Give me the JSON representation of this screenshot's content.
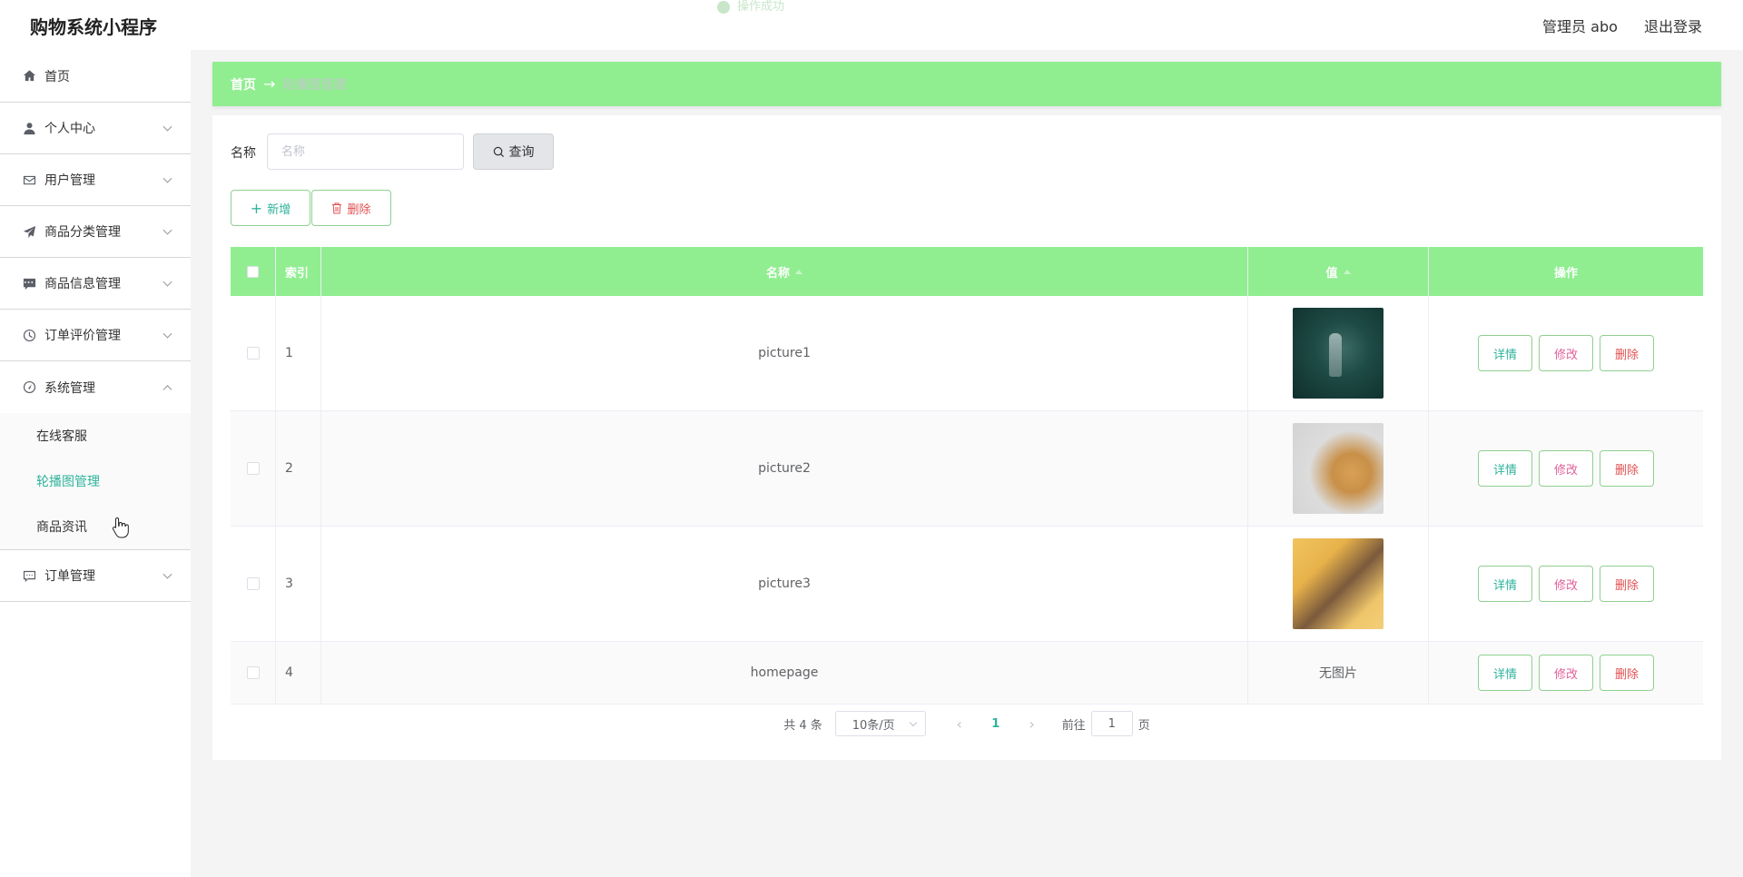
{
  "app": {
    "title": "购物系统小程序"
  },
  "toast": {
    "message": "操作成功"
  },
  "header": {
    "user_label": "管理员 abo",
    "logout_label": "退出登录"
  },
  "sidebar": {
    "items": [
      {
        "label": "首页",
        "icon": "home-icon"
      },
      {
        "label": "个人中心",
        "icon": "user-icon"
      },
      {
        "label": "用户管理",
        "icon": "mail-icon"
      },
      {
        "label": "商品分类管理",
        "icon": "send-icon"
      },
      {
        "label": "商品信息管理",
        "icon": "chat-icon"
      },
      {
        "label": "订单评价管理",
        "icon": "clock-icon"
      },
      {
        "label": "系统管理",
        "icon": "gauge-icon"
      },
      {
        "label": "订单管理",
        "icon": "message-icon"
      }
    ],
    "submenu": [
      {
        "label": "在线客服"
      },
      {
        "label": "轮播图管理",
        "active": true
      },
      {
        "label": "商品资讯"
      }
    ]
  },
  "breadcrumb": {
    "home": "首页",
    "arrow": "→",
    "current": "轮播图管理"
  },
  "search": {
    "label": "名称",
    "placeholder": "名称",
    "button_label": "查询"
  },
  "actions": {
    "add_label": "新增",
    "delete_label": "删除"
  },
  "table": {
    "headers": {
      "index": "索引",
      "name": "名称",
      "value": "值",
      "ops": "操作"
    },
    "rows": [
      {
        "index": "1",
        "name": "picture1",
        "value": "image",
        "thumb": "t1"
      },
      {
        "index": "2",
        "name": "picture2",
        "value": "image",
        "thumb": "t2"
      },
      {
        "index": "3",
        "name": "picture3",
        "value": "image",
        "thumb": "t3"
      },
      {
        "index": "4",
        "name": "homepage",
        "value": "无图片",
        "thumb": ""
      }
    ],
    "op_labels": {
      "detail": "详情",
      "edit": "修改",
      "delete": "删除"
    }
  },
  "pagination": {
    "total": "共 4 条",
    "page_size": "10条/页",
    "current_page": "1",
    "goto_label": "前往",
    "goto_value": "1",
    "unit": "页"
  },
  "colors": {
    "accent": "#90ee90",
    "active_text": "#2fb39c",
    "danger": "#e05050"
  }
}
